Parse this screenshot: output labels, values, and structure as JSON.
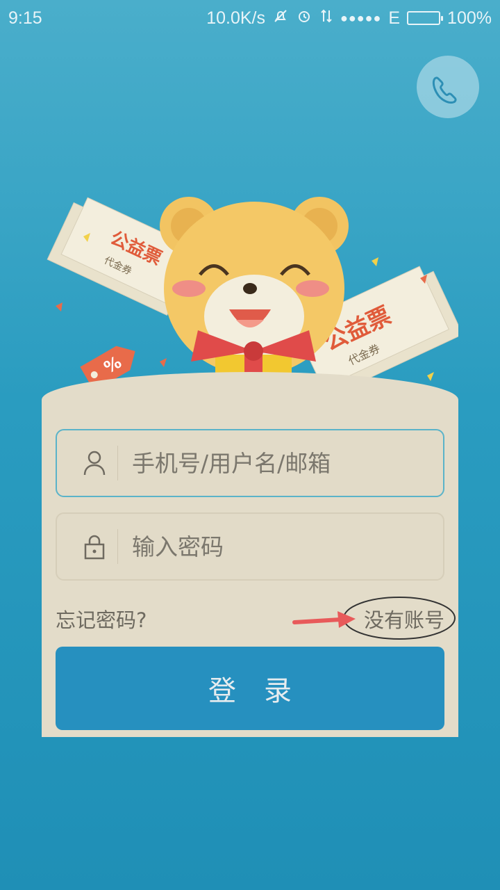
{
  "status_bar": {
    "time": "9:15",
    "net_speed": "10.0K/s",
    "network_type": "E",
    "battery": "100%",
    "icons": [
      "mute-icon",
      "alarm-icon",
      "data-arrows-icon",
      "signal-icon",
      "battery-icon"
    ]
  },
  "phone_button": {
    "icon": "phone-icon"
  },
  "illustration": {
    "ticket_left_title": "公益票",
    "ticket_left_sub": "代金券",
    "ticket_right_title": "公益票",
    "ticket_right_sub": "代金券",
    "tag_label": "%"
  },
  "login": {
    "username_placeholder": "手机号/用户名/邮箱",
    "password_placeholder": "输入密码",
    "forgot_label": "忘记密码?",
    "signup_label": "没有账号",
    "login_label": "登录"
  },
  "colors": {
    "background": "#2a9cc0",
    "card": "#e3dcc9",
    "button": "#2690bf",
    "focus_border": "#5ab3c9",
    "annotation_arrow": "#e85a5a"
  }
}
